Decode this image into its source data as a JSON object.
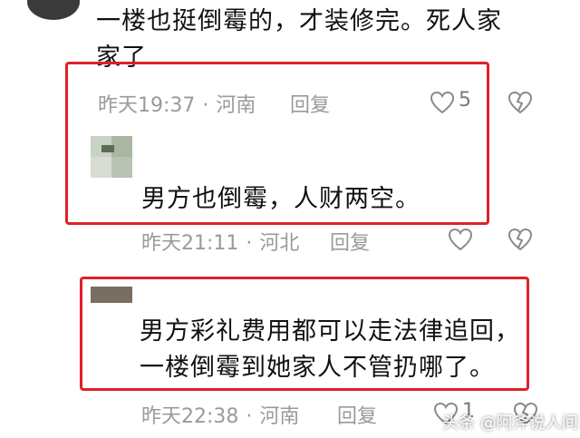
{
  "comment1": {
    "text_line1": "一楼也挺倒霉的，才装修完。死人家",
    "text_line2": "家了",
    "time": "昨天19:37",
    "separator": "·",
    "location": "河南",
    "reply_label": "回复",
    "like_count": "5"
  },
  "reply1": {
    "text": "男方也倒霉，人财两空。",
    "time": "昨天21:11",
    "separator": "·",
    "location": "河北",
    "reply_label": "回复"
  },
  "reply2": {
    "text_line1": "男方彩礼费用都可以走法律追回，",
    "text_line2": "一楼倒霉到她家人不管扔哪了。",
    "time": "昨天22:38",
    "separator": "·",
    "location": "河南",
    "reply_label": "回复",
    "like_count": "1"
  },
  "watermark": {
    "text": "头条 @阿斧说人间"
  },
  "colors": {
    "highlight": "#e0202a",
    "meta_gray": "#9a9a9a"
  },
  "icons": [
    "heart-outline-icon",
    "broken-heart-icon"
  ]
}
